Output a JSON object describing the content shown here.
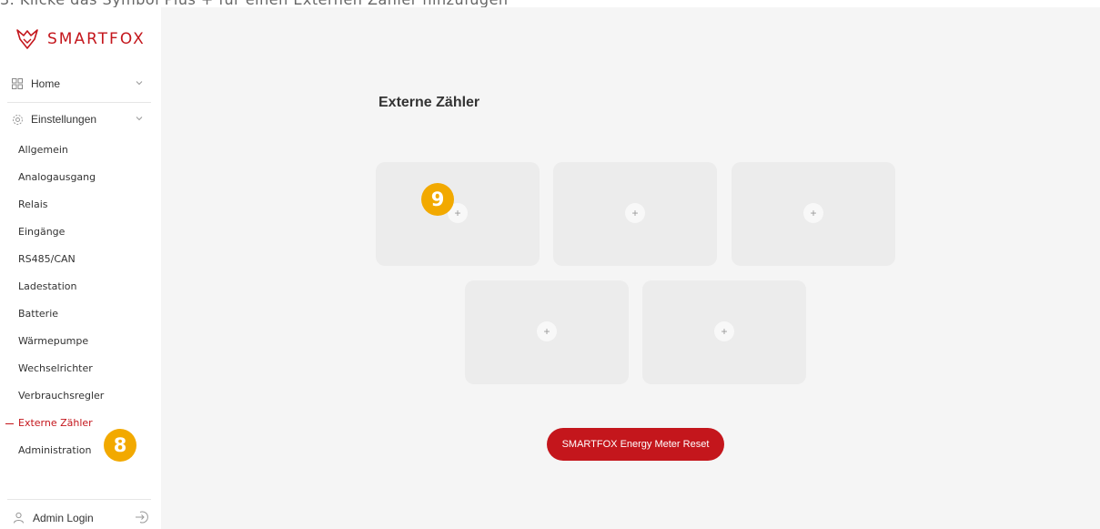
{
  "top_note": "3. Klicke das Symbol Plus + für einen Externen Zähler hinzufügen",
  "brand": {
    "name": "SMARTFOX",
    "color": "#c4161c"
  },
  "nav": {
    "home": "Home",
    "settings": "Einstellungen",
    "settings_items": [
      "Allgemein",
      "Analogausgang",
      "Relais",
      "Eingänge",
      "RS485/CAN",
      "Ladestation",
      "Batterie",
      "Wärmepumpe",
      "Wechselrichter",
      "Verbrauchsregler",
      "Externe Zähler",
      "Administration"
    ],
    "active_item": "Externe Zähler",
    "admin_login": "Admin Login"
  },
  "main": {
    "title": "Externe Zähler",
    "tiles": [
      {
        "icon": "plus-icon",
        "label": "+"
      },
      {
        "icon": "plus-icon",
        "label": "+"
      },
      {
        "icon": "plus-icon",
        "label": "+"
      },
      {
        "icon": "plus-icon",
        "label": "+"
      },
      {
        "icon": "plus-icon",
        "label": "+"
      }
    ],
    "reset_button": "SMARTFOX Energy Meter Reset"
  },
  "badges": {
    "sidebar_badge": "8",
    "tile_badge": "9",
    "color": "#f2a900"
  }
}
